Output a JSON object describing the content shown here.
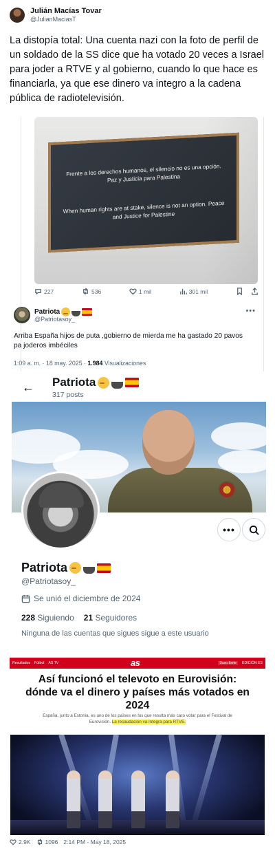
{
  "author": {
    "name": "Julián Macías Tovar",
    "handle": "@JulianMaciasT"
  },
  "tweet_text": "La distopía total: Una cuenta nazi con la foto de perfil de un soldado de la SS dice que ha votado 20 veces a Israel para joder a RTVE y al gobierno, cuando lo que hace es financiarla, ya que ese dinero va integro a la cadena pública de radiotelevisión.",
  "embedded_photo": {
    "screen_text_es": "Frente a los derechos humanos, el silencio no es una opción. Paz y Justicia para Palestina",
    "screen_text_en": "When human rights are at stake, silence is not an option. Peace and Justice for Palestine"
  },
  "embedded_actions": {
    "replies": "227",
    "retweets": "536",
    "likes": "1 mil",
    "views": "301 mil"
  },
  "reply": {
    "name": "Patriota",
    "handle": "@Patriotasoy_",
    "text": "Arriba España hijos de puta ,gobierno de mierda me ha gastado 20 pavos pa joderos imbéciles",
    "time": "1:09 a. m. · 18 may. 2025 · ",
    "views_count": "1.984",
    "views_label": " Visualizaciones"
  },
  "profile": {
    "name": "Patriota",
    "posts": "317 posts",
    "handle": "@Patriotasoy_",
    "joined": "Se unió el diciembre de 2024",
    "following_count": "228",
    "following_label": " Siguiendo",
    "followers_count": "21",
    "followers_label": " Seguidores",
    "note": "Ninguna de las cuentas que sigues sigue a este usuario"
  },
  "article": {
    "nav": [
      "Resultados",
      "Fútbol",
      "AS TV"
    ],
    "logo": "as",
    "subscribe": "Suscríbete",
    "edition": "EDICIÓN ES",
    "title": "Así funcionó el televoto en Eurovisión: dónde va el dinero y países más votados en 2024",
    "lead_plain": "España, junto a Estonia, es uno de los países en los que resulta más caro votar para el Festival de Eurovisión. ",
    "lead_highlight": "La recaudación va íntegra para RTVE."
  },
  "bottom": {
    "likes": "2.9K",
    "retweets": "1096",
    "timestamp": "2:14 PM - May 18, 2025"
  },
  "colors": {
    "as_red": "#d0021b",
    "highlight": "#f6ef4b",
    "muted_text": "#536471"
  },
  "icons": [
    "reply-icon",
    "retweet-icon",
    "like-icon",
    "views-icon",
    "bookmark-icon",
    "share-icon",
    "back-arrow-icon",
    "more-icon",
    "search-icon",
    "calendar-icon"
  ]
}
